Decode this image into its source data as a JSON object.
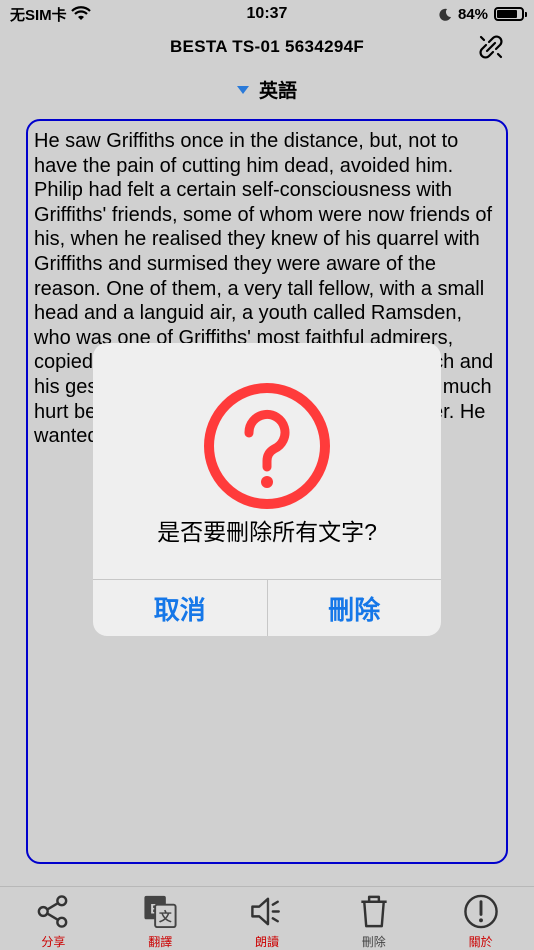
{
  "status": {
    "carrier": "无SIM卡",
    "time": "10:37",
    "battery": "84%",
    "battery_level": 0.84
  },
  "nav": {
    "title": "BESTA TS-01 5634294F"
  },
  "language": {
    "label": "英語"
  },
  "textbox": {
    "content": "He saw Griffiths once in the distance, but, not to have the pain of cutting him dead, avoided him. Philip had felt a certain self-consciousness with Griffiths' friends, some of whom were now friends of his, when he realised they knew of his quarrel with Griffiths and surmised they were aware of the reason. One of them, a very tall fellow, with a small head and a languid air, a youth called Ramsden, who was one of Griffiths' most faithful admirers, copied his ties, his boots, his manner of speech and his gestures, told Philip that Griffiths was very much hurt because Philip had not answered his letter. He wanted to be reconciled to him."
  },
  "dialog": {
    "message": "是否要刪除所有文字?",
    "cancel_label": "取消",
    "delete_label": "刪除"
  },
  "tabs": [
    {
      "label": "分享",
      "icon": "share-icon"
    },
    {
      "label": "翻譯",
      "icon": "translate-icon"
    },
    {
      "label": "朗讀",
      "icon": "speaker-icon"
    },
    {
      "label": "刪除",
      "icon": "trash-icon"
    },
    {
      "label": "關於",
      "icon": "info-icon"
    }
  ],
  "colors": {
    "accent": "#1577e8",
    "border": "#0000cc",
    "warning": "#ff3b3b",
    "tab_label": "#cc0000"
  }
}
